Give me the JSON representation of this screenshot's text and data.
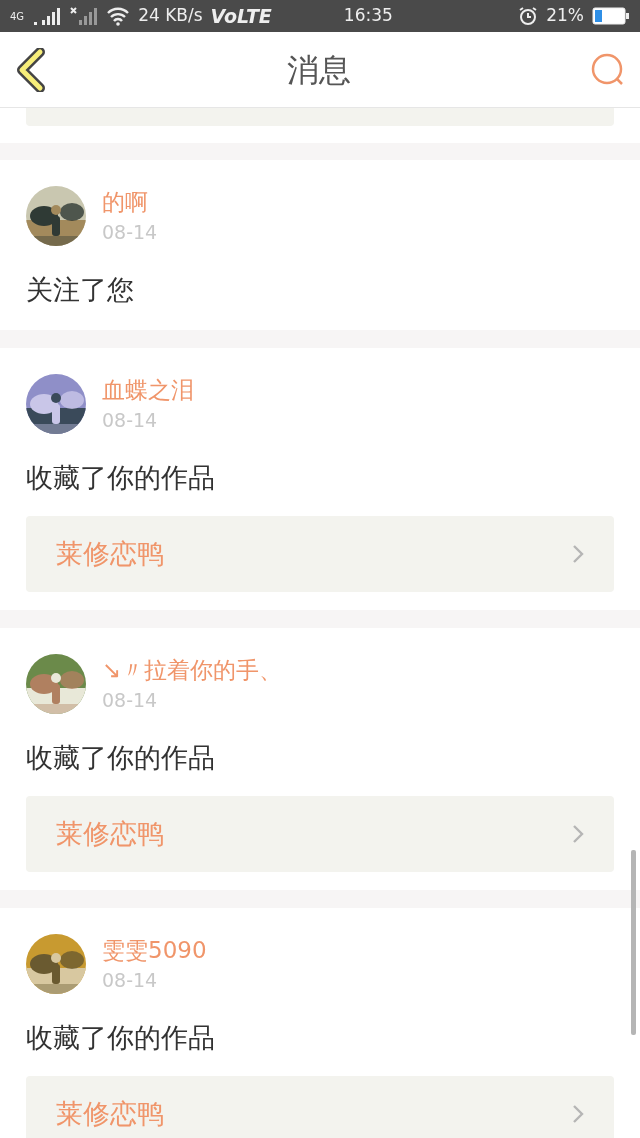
{
  "status_bar": {
    "network": "4G",
    "speed": "24 KB/s",
    "carrier_mode": "VoLTE",
    "time": "16:35",
    "battery": "21%"
  },
  "header": {
    "title": "消息"
  },
  "messages": [
    {
      "name": "的啊",
      "date": "08-14",
      "action": "关注了您"
    },
    {
      "name": "血蝶之泪",
      "date": "08-14",
      "action": "收藏了你的作品",
      "work": "莱修恋鸭"
    },
    {
      "name": "↘〃拉着你的手、",
      "date": "08-14",
      "action": "收藏了你的作品",
      "work": "莱修恋鸭"
    },
    {
      "name": "雯雯5090",
      "date": "08-14",
      "action": "收藏了你的作品",
      "work": "莱修恋鸭"
    }
  ]
}
